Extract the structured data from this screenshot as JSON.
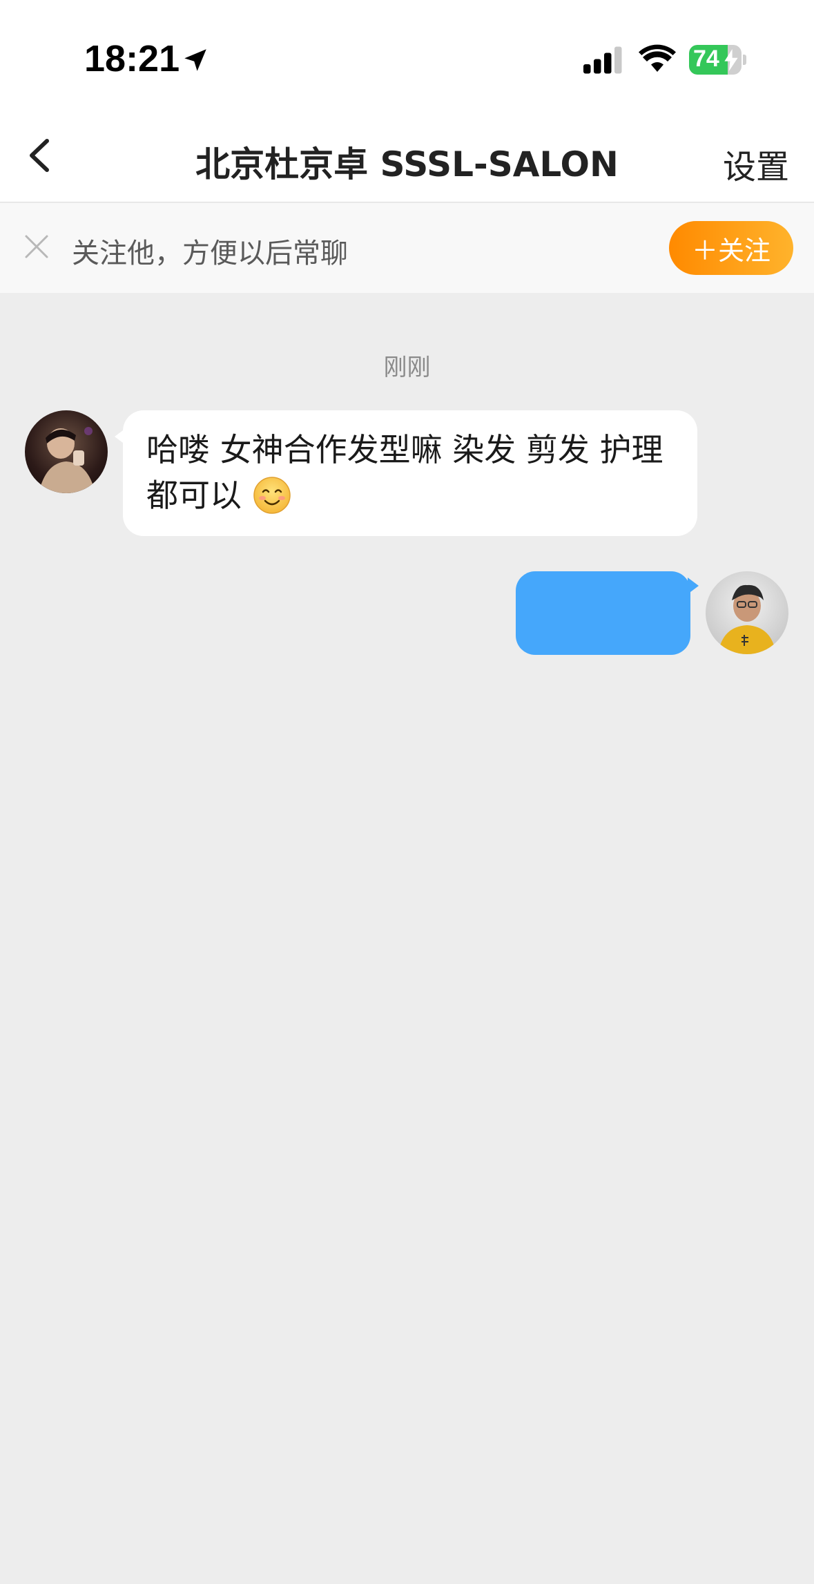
{
  "status_bar": {
    "time": "18:21",
    "battery_level": "74",
    "battery_fraction": 0.74,
    "icons": [
      "location-arrow-icon",
      "cellular-signal-icon",
      "wifi-icon",
      "battery-charging-icon"
    ]
  },
  "nav": {
    "title": "北京杜京卓 SSSL-SALON",
    "settings_label": "设置",
    "back_icon": "chevron-left-icon"
  },
  "follow_banner": {
    "text": "关注他，方便以后常聊",
    "button_label": "＋关注",
    "close_icon": "close-icon",
    "button_gradient": [
      "#ff8a00",
      "#ffb32c"
    ]
  },
  "chat": {
    "timestamp": "刚刚",
    "messages": [
      {
        "direction": "incoming",
        "text": "哈喽 女神合作发型嘛 染发 剪发 护理都可以",
        "emoji": "smiling-face-emoji"
      },
      {
        "direction": "outgoing",
        "text": "",
        "bubble_color": "#45a7fb"
      }
    ]
  },
  "colors": {
    "chat_background": "#ededed",
    "accent_orange": "#ff8a00",
    "outgoing_bubble": "#45a7fb",
    "battery_green": "#34c759"
  }
}
